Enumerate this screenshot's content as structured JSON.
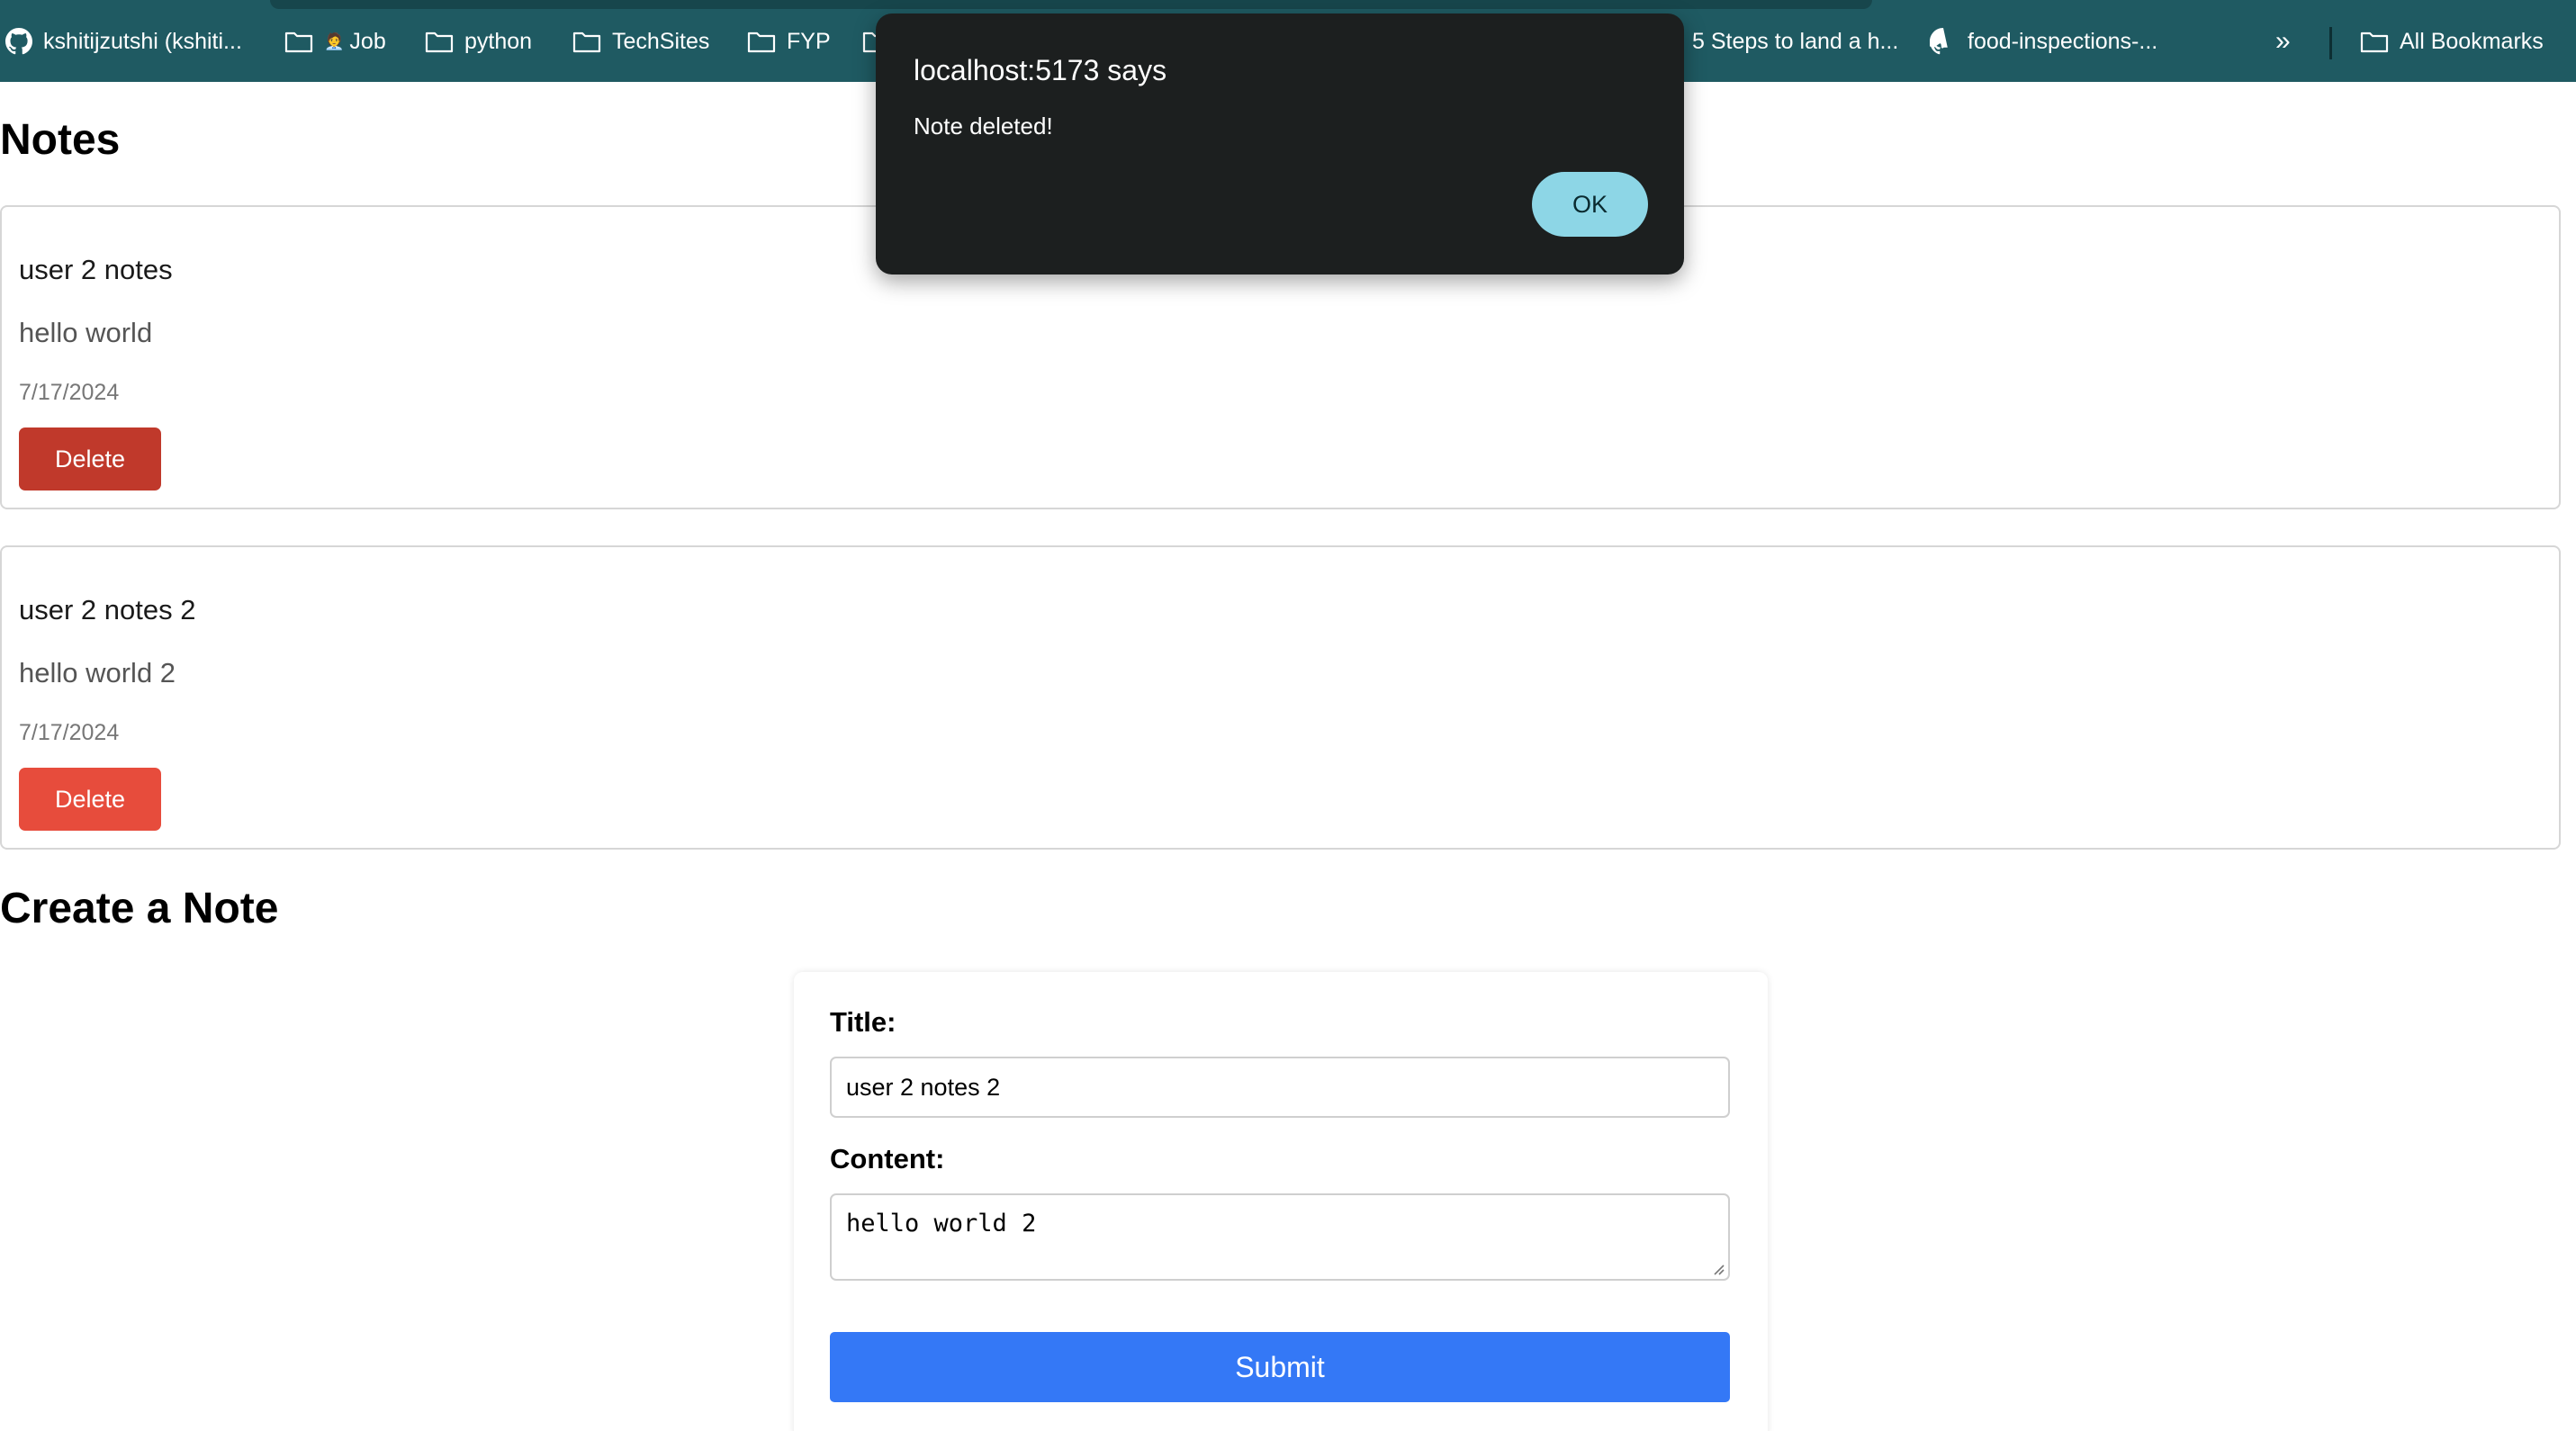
{
  "colors": {
    "bookmark_bar": "#1f5a62",
    "delete_dark": "#c0392b",
    "delete_normal": "#e74c3c",
    "submit": "#3478f6",
    "dialog_bg": "#1c1f1f",
    "ok_button": "#8dd6e6"
  },
  "bookmarks": {
    "items": [
      {
        "label": "kshitijzutshi (kshiti...",
        "icon": "github-icon"
      },
      {
        "label": "Job",
        "icon": "folder-icon",
        "emoji": "🧑‍💼"
      },
      {
        "label": "python",
        "icon": "folder-icon"
      },
      {
        "label": "TechSites",
        "icon": "folder-icon"
      },
      {
        "label": "FYP",
        "icon": "folder-icon"
      },
      {
        "label": "5 Steps to land a h...",
        "icon": "none"
      },
      {
        "label": "food-inspections-...",
        "icon": "github-icon"
      }
    ],
    "overflow": "»",
    "all_bookmarks": "All Bookmarks"
  },
  "notes": {
    "heading": "Notes",
    "items": [
      {
        "title": "user 2 notes",
        "content": "hello world",
        "date": "7/17/2024",
        "delete_label": "Delete"
      },
      {
        "title": "user 2 notes 2",
        "content": "hello world 2",
        "date": "7/17/2024",
        "delete_label": "Delete"
      }
    ]
  },
  "create": {
    "heading": "Create a Note",
    "title_label": "Title:",
    "title_value": "user 2 notes 2",
    "content_label": "Content:",
    "content_value": "hello world 2",
    "submit_label": "Submit"
  },
  "dialog": {
    "title": "localhost:5173 says",
    "message": "Note deleted!",
    "ok_label": "OK"
  }
}
